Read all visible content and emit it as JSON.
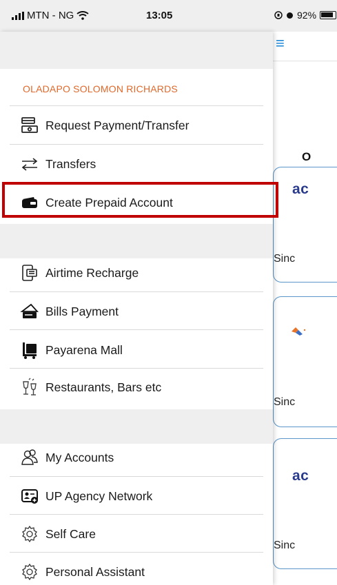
{
  "status_bar": {
    "carrier": "MTN - NG",
    "time": "13:05",
    "battery": "92%"
  },
  "drawer": {
    "user_name": "OLADAPO SOLOMON RICHARDS",
    "group1": [
      {
        "label": "Request Payment/Transfer",
        "icon": "request-payment-icon"
      },
      {
        "label": "Transfers",
        "icon": "transfer-arrows-icon"
      },
      {
        "label": "Create Prepaid Account",
        "icon": "prepaid-card-icon"
      }
    ],
    "group2": [
      {
        "label": "Airtime Recharge",
        "icon": "phone-recharge-icon"
      },
      {
        "label": "Bills Payment",
        "icon": "bills-icon"
      },
      {
        "label": "Payarena Mall",
        "icon": "shopping-cart-icon"
      },
      {
        "label": "Restaurants, Bars etc",
        "icon": "drinks-icon"
      }
    ],
    "group3": [
      {
        "label": "My Accounts",
        "icon": "accounts-people-icon"
      },
      {
        "label": "UP Agency Network",
        "icon": "agency-network-icon"
      },
      {
        "label": "Self Care",
        "icon": "gear-icon"
      },
      {
        "label": "Personal Assistant",
        "icon": "gear-icon"
      }
    ]
  },
  "background_page": {
    "section_title": "O",
    "cards": [
      {
        "brand": "ac",
        "since": "Sinc"
      },
      {
        "brand": "",
        "since": "Sinc"
      },
      {
        "brand": "ac",
        "since": "Sinc"
      }
    ]
  },
  "colors": {
    "accent_orange": "#e0682a",
    "highlight_red": "#c00000",
    "card_border": "#5b95c8",
    "brand_navy": "#2b3b8c"
  }
}
